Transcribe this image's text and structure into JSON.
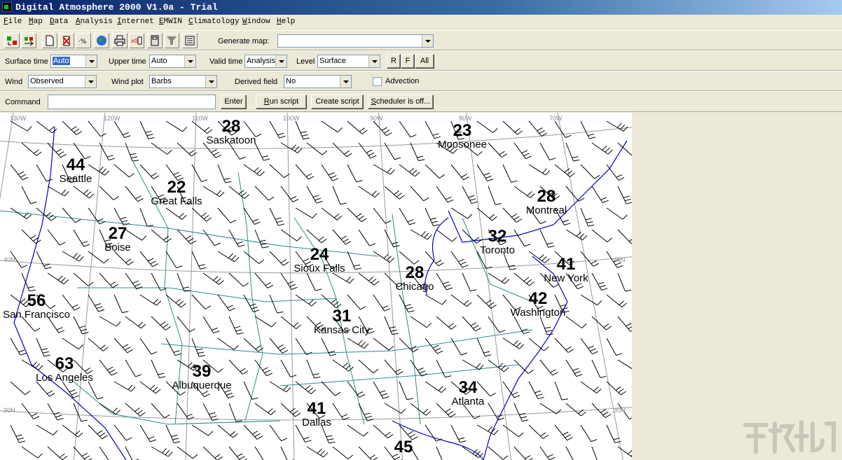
{
  "window": {
    "title": "Digital Atmosphere 2000 V1.0a - Trial"
  },
  "menu": {
    "items": [
      {
        "first": "F",
        "rest": "ile"
      },
      {
        "first": "M",
        "rest": "ap"
      },
      {
        "first": "D",
        "rest": "ata"
      },
      {
        "first": "A",
        "rest": "nalysis"
      },
      {
        "first": "I",
        "rest": "nternet"
      },
      {
        "first": "E",
        "rest": "MWIN"
      },
      {
        "first": "C",
        "rest": "limatology"
      },
      {
        "first": "W",
        "rest": "indow"
      },
      {
        "first": "H",
        "rest": "elp"
      }
    ]
  },
  "toolbar": {
    "icons": [
      "open-data-icon",
      "transfer-icon",
      "new-document-icon",
      "delete-icon",
      "stats-icon",
      "globe-icon",
      "print-icon",
      "calc-icon",
      "calculator-icon",
      "filter-icon",
      "report-icon"
    ],
    "generate_map_label": "Generate map:",
    "generate_map_value": ""
  },
  "row1": {
    "surface_time_label": "Surface time",
    "surface_time_value": "Auto",
    "upper_time_label": "Upper time",
    "upper_time_value": "Auto",
    "valid_time_label": "Valid time",
    "valid_time_value": "Analysis",
    "level_label": "Level",
    "level_value": "Surface",
    "btn_r": "R",
    "btn_f": "F",
    "btn_all": "All"
  },
  "row2": {
    "wind_label": "Wind",
    "wind_value": "Observed",
    "wind_plot_label": "Wind plot",
    "wind_plot_value": "Barbs",
    "derived_field_label": "Derived field",
    "derived_field_value": "No",
    "advection_label": "Advection"
  },
  "row3": {
    "command_label": "Command",
    "command_value": "",
    "enter_label": "Enter",
    "run_script_first": "R",
    "run_script_rest": "un script",
    "create_script_label": "Create script",
    "scheduler_first": "S",
    "scheduler_rest": "cheduler is off..."
  },
  "map": {
    "longitudes": [
      "130W",
      "120W",
      "110W",
      "100W",
      "90W",
      "80W",
      "70W"
    ],
    "latitudes": [
      "40N",
      "40N",
      "30N",
      "30N"
    ],
    "cities": [
      {
        "name": "Saskatoon",
        "value": "28"
      },
      {
        "name": "Moosonee",
        "value": "23"
      },
      {
        "name": "Seattle",
        "value": "44"
      },
      {
        "name": "Great Falls",
        "value": "22"
      },
      {
        "name": "Montreal",
        "value": "28"
      },
      {
        "name": "Boise",
        "value": "27"
      },
      {
        "name": "Toronto",
        "value": "32"
      },
      {
        "name": "Sioux Falls",
        "value": "24"
      },
      {
        "name": "Chicago",
        "value": "28"
      },
      {
        "name": "New York",
        "value": "41"
      },
      {
        "name": "San Francisco",
        "value": "56"
      },
      {
        "name": "Washington",
        "value": "42"
      },
      {
        "name": "Kansas City",
        "value": "31"
      },
      {
        "name": "Los Angeles",
        "value": "63"
      },
      {
        "name": "Albuquerque",
        "value": "39"
      },
      {
        "name": "Atlanta",
        "value": "34"
      },
      {
        "name": "Dallas",
        "value": "41"
      },
      {
        "name": "",
        "value": "45"
      }
    ]
  },
  "colors": {
    "title_bar": "#0a246a",
    "coast": "#0000cc",
    "state_lines": "#2e8b8b",
    "grid": "#999999",
    "barbs": "#000000"
  }
}
